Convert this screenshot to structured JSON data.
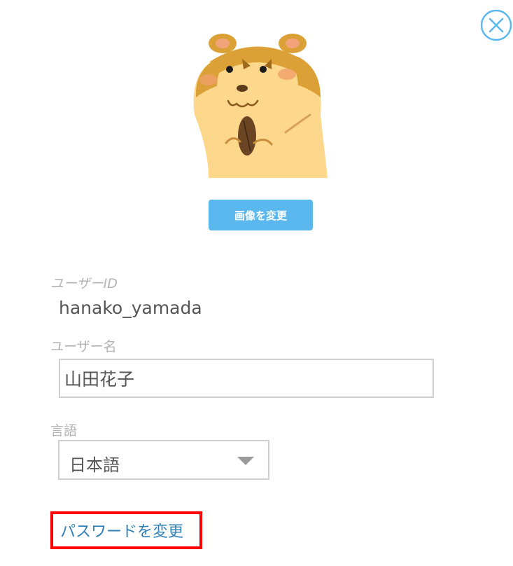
{
  "close": {
    "icon": "close-icon"
  },
  "avatar": {
    "icon": "hamster-icon"
  },
  "actions": {
    "change_image_label": "画像を変更"
  },
  "profile": {
    "user_id_label": "ユーザーID",
    "user_id_value": "hanako_yamada",
    "user_name_label": "ユーザー名",
    "user_name_value": "山田花子",
    "language_label": "言語",
    "language_value": "日本語"
  },
  "links": {
    "change_password_label": "パスワードを変更"
  },
  "colors": {
    "accent": "#5bb8ee",
    "link": "#2f80b8",
    "highlight_border": "#ff0000",
    "label": "#b3b3b3",
    "text": "#555555"
  }
}
